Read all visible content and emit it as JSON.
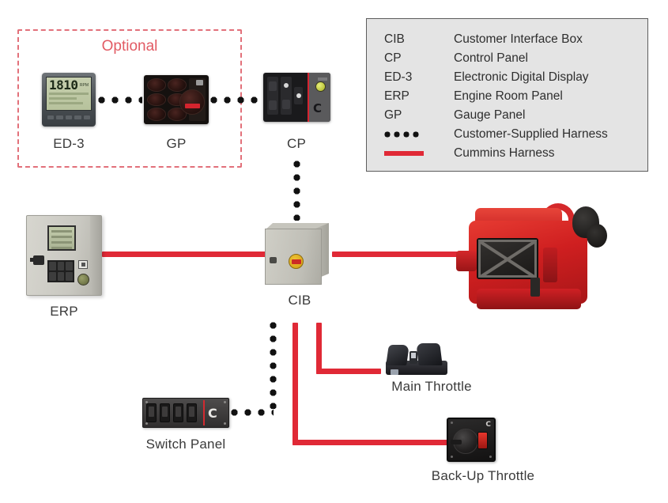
{
  "diagram": {
    "optional_label": "Optional",
    "accent_red": "#E02936",
    "optional_red": "#E25B64",
    "legend_bg": "#E4E4E4"
  },
  "legend": {
    "rows": [
      {
        "key": "CIB",
        "value": "Customer Interface Box",
        "key_type": "text"
      },
      {
        "key": "CP",
        "value": "Control Panel",
        "key_type": "text"
      },
      {
        "key": "ED-3",
        "value": "Electronic Digital Display",
        "key_type": "text"
      },
      {
        "key": "ERP",
        "value": "Engine Room Panel",
        "key_type": "text"
      },
      {
        "key": "GP",
        "value": "Gauge Panel",
        "key_type": "text"
      },
      {
        "key": "",
        "value": "Customer-Supplied Harness",
        "key_type": "dots"
      },
      {
        "key": "",
        "value": "Cummins Harness",
        "key_type": "line"
      }
    ]
  },
  "nodes": {
    "ed3": {
      "label": "ED-3",
      "display_value": "1810",
      "display_unit": "RPM"
    },
    "gp": {
      "label": "GP"
    },
    "cp": {
      "label": "CP",
      "brand": "C"
    },
    "erp": {
      "label": "ERP"
    },
    "cib": {
      "label": "CIB"
    },
    "engine": {
      "label": ""
    },
    "switch_panel": {
      "label": "Switch Panel",
      "brand": "C"
    },
    "main_throttle": {
      "label": "Main Throttle"
    },
    "backup_throttle": {
      "label": "Back-Up Throttle",
      "brand": "C"
    }
  }
}
